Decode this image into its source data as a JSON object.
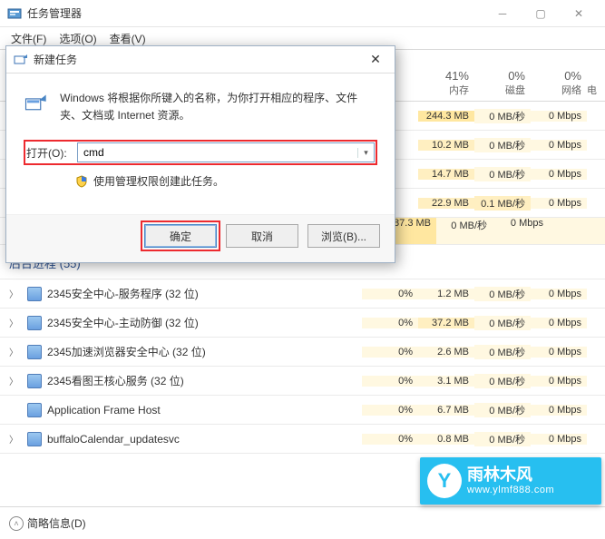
{
  "titlebar": {
    "title": "任务管理器"
  },
  "menubar": {
    "file": "文件(F)",
    "options": "选项(O)",
    "view": "查看(V)"
  },
  "dialog": {
    "title": "新建任务",
    "description": "Windows 将根据你所键入的名称，为你打开相应的程序、文件夹、文档或 Internet 资源。",
    "open_label": "打开(O):",
    "input_value": "cmd",
    "admin_text": "使用管理权限创建此任务。",
    "ok": "确定",
    "cancel": "取消",
    "browse": "浏览(B)..."
  },
  "columns": {
    "mem_pct": "41%",
    "mem_label": "内存",
    "disk_pct": "0%",
    "disk_label": "磁盘",
    "net_pct": "0%",
    "net_label": "网络",
    "power_label": "电"
  },
  "visible_rows": [
    {
      "mem": "244.3 MB",
      "disk": "0 MB/秒",
      "net": "0 Mbps"
    },
    {
      "mem": "10.2 MB",
      "disk": "0 MB/秒",
      "net": "0 Mbps"
    },
    {
      "mem": "14.7 MB",
      "disk": "0 MB/秒",
      "net": "0 Mbps"
    },
    {
      "mem": "22.9 MB",
      "disk": "0.1 MB/秒",
      "net": "0 Mbps"
    },
    {
      "mem": "87.3 MB",
      "disk": "0 MB/秒",
      "net": "0 Mbps"
    }
  ],
  "section": {
    "bg_processes": "后台进程 (55)"
  },
  "processes": [
    {
      "name": "2345安全中心-服务程序 (32 位)",
      "cpu": "0%",
      "mem": "1.2 MB",
      "disk": "0 MB/秒",
      "net": "0 Mbps",
      "exp": true
    },
    {
      "name": "2345安全中心-主动防御 (32 位)",
      "cpu": "0%",
      "mem": "37.2 MB",
      "disk": "0 MB/秒",
      "net": "0 Mbps",
      "exp": true
    },
    {
      "name": "2345加速浏览器安全中心 (32 位)",
      "cpu": "0%",
      "mem": "2.6 MB",
      "disk": "0 MB/秒",
      "net": "0 Mbps",
      "exp": true
    },
    {
      "name": "2345看图王核心服务 (32 位)",
      "cpu": "0%",
      "mem": "3.1 MB",
      "disk": "0 MB/秒",
      "net": "0 Mbps",
      "exp": true
    },
    {
      "name": "Application Frame Host",
      "cpu": "0%",
      "mem": "6.7 MB",
      "disk": "0 MB/秒",
      "net": "0 Mbps",
      "exp": false
    },
    {
      "name": "buffaloCalendar_updatesvc",
      "cpu": "0%",
      "mem": "0.8 MB",
      "disk": "0 MB/秒",
      "net": "0 Mbps",
      "exp": true
    }
  ],
  "footer": {
    "less_info": "简略信息(D)"
  },
  "watermark": {
    "brand": "雨林木风",
    "url": "www.ylmf888.com"
  }
}
